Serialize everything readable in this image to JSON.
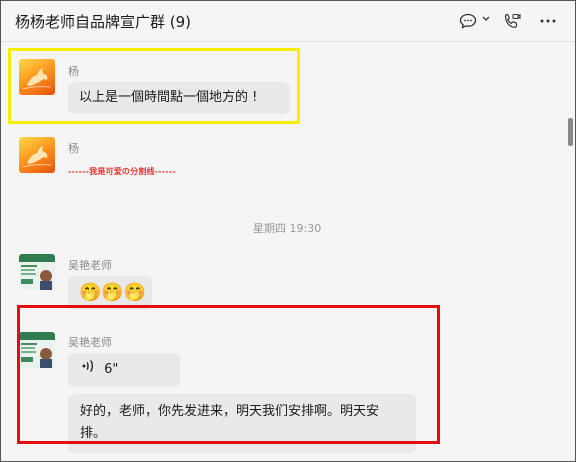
{
  "header": {
    "title": "杨杨老师自品牌宣广群 (9)",
    "icons": [
      "chat-bubble-icon",
      "chevron-down-icon",
      "video-call-icon",
      "more-icon"
    ]
  },
  "messages": [
    {
      "sender": "杨",
      "text": "以上是一個時間點一個地方的 !"
    },
    {
      "sender": "杨",
      "text": "------我是可爱の分割线------"
    },
    {
      "sender": "吴艳老师",
      "emoji": "🤭🤭🤭"
    },
    {
      "sender": "吴艳老师",
      "voice_duration": "6\"",
      "text": "好的，老师，你先发进来，明天我们安排啊。明天安排。"
    }
  ],
  "timestamp": "星期四 19:30",
  "colors": {
    "highlight_yellow": "#f6f000",
    "highlight_red": "#e01010",
    "divider_red": "#e8342f"
  }
}
